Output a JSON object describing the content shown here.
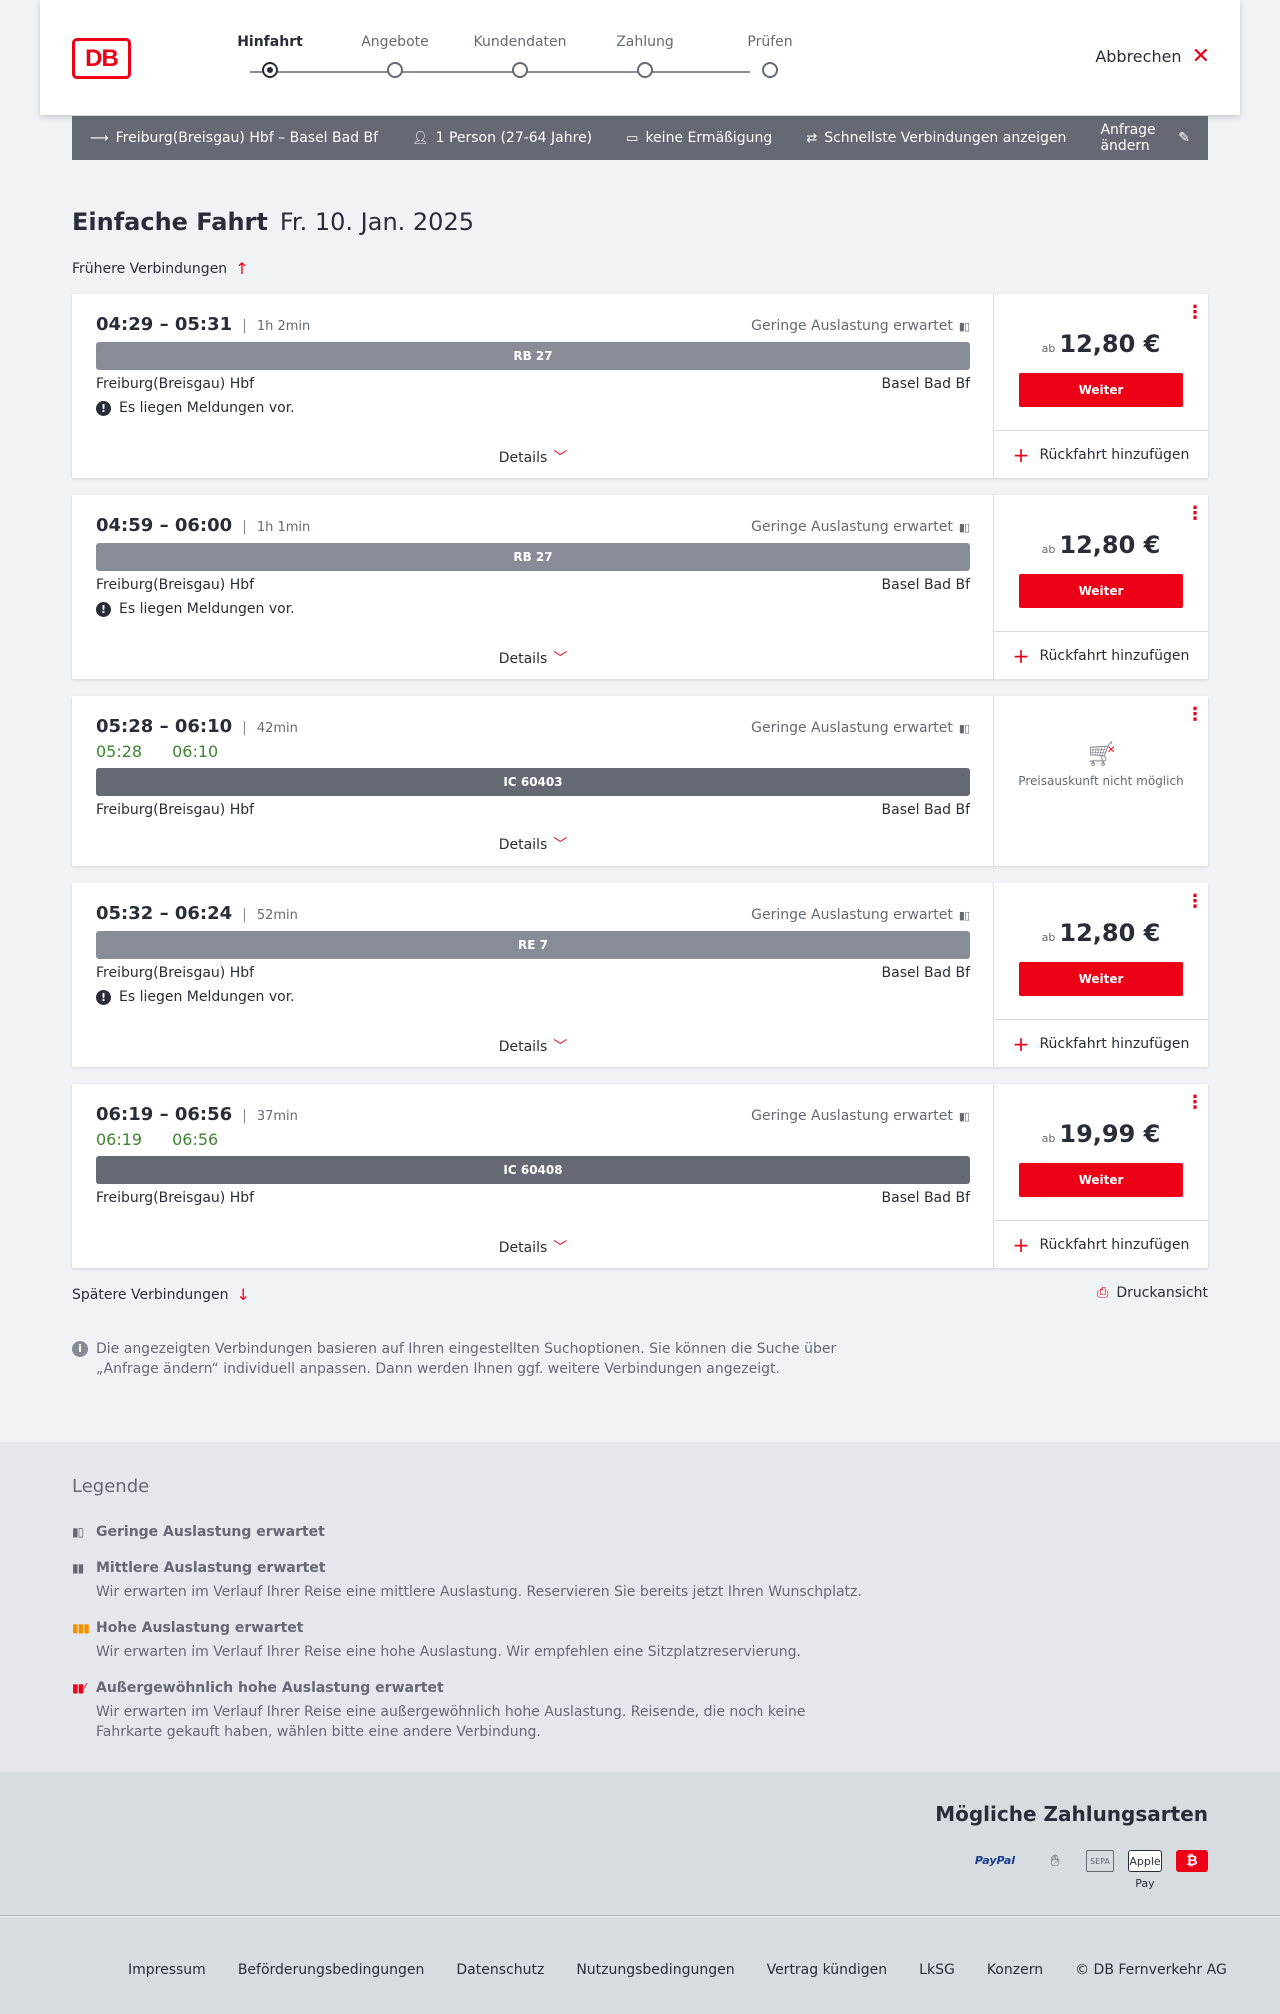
{
  "header": {
    "logo": "DB",
    "steps": [
      "Hinfahrt",
      "Angebote",
      "Kundendaten",
      "Zahlung",
      "Prüfen"
    ],
    "active_step": 0,
    "cancel": "Abbrechen"
  },
  "search": {
    "route": "Freiburg(Breisgau) Hbf – Basel Bad Bf",
    "persons": "1 Person (27-64 Jahre)",
    "discount": "keine Ermäßigung",
    "fastest": "Schnellste Verbindungen anzeigen",
    "edit": "Anfrage ändern"
  },
  "title": {
    "main": "Einfache Fahrt",
    "date": "Fr. 10. Jan. 2025"
  },
  "earlier": "Frühere Verbindungen",
  "later": "Spätere Verbindungen",
  "print": "Druckansicht",
  "connections": [
    {
      "times": "04:29 – 05:31",
      "duration": "1h 2min",
      "load": "Geringe Auslastung erwartet",
      "realtime": null,
      "train": "RB 27",
      "from": "Freiburg(Breisgau) Hbf",
      "to": "Basel Bad Bf",
      "message": "Es liegen Meldungen vor.",
      "details": "Details",
      "price_prefix": "ab",
      "price": "12,80 €",
      "button": "Weiter",
      "return": "Rückfahrt hinzufügen"
    },
    {
      "times": "04:59 – 06:00",
      "duration": "1h 1min",
      "load": "Geringe Auslastung erwartet",
      "realtime": null,
      "train": "RB 27",
      "from": "Freiburg(Breisgau) Hbf",
      "to": "Basel Bad Bf",
      "message": "Es liegen Meldungen vor.",
      "details": "Details",
      "price_prefix": "ab",
      "price": "12,80 €",
      "button": "Weiter",
      "return": "Rückfahrt hinzufügen"
    },
    {
      "times": "05:28 – 06:10",
      "duration": "42min",
      "load": "Geringe Auslastung erwartet",
      "realtime": {
        "dep": "05:28",
        "arr": "06:10"
      },
      "train": "IC 60403",
      "from": "Freiburg(Breisgau) Hbf",
      "to": "Basel Bad Bf",
      "message": null,
      "details": "Details",
      "no_price": "Preisauskunft nicht möglich"
    },
    {
      "times": "05:32 – 06:24",
      "duration": "52min",
      "load": "Geringe Auslastung erwartet",
      "realtime": null,
      "train": "RE 7",
      "from": "Freiburg(Breisgau) Hbf",
      "to": "Basel Bad Bf",
      "message": "Es liegen Meldungen vor.",
      "details": "Details",
      "price_prefix": "ab",
      "price": "12,80 €",
      "button": "Weiter",
      "return": "Rückfahrt hinzufügen"
    },
    {
      "times": "06:19 – 06:56",
      "duration": "37min",
      "load": "Geringe Auslastung erwartet",
      "realtime": {
        "dep": "06:19",
        "arr": "06:56"
      },
      "train": "IC 60408",
      "from": "Freiburg(Breisgau) Hbf",
      "to": "Basel Bad Bf",
      "message": null,
      "details": "Details",
      "price_prefix": "ab",
      "price": "19,99 €",
      "button": "Weiter",
      "return": "Rückfahrt hinzufügen"
    }
  ],
  "info": "Die angezeigten Verbindungen basieren auf Ihren eingestellten Suchoptionen. Sie können die Suche über „Anfrage ändern“ individuell anpassen. Dann werden Ihnen ggf. weitere Verbindungen angezeigt.",
  "legend": {
    "title": "Legende",
    "items": [
      {
        "title": "Geringe Auslastung erwartet",
        "text": "",
        "color": "#646973"
      },
      {
        "title": "Mittlere Auslastung erwartet",
        "text": "Wir erwarten im Verlauf Ihrer Reise eine mittlere Auslastung. Reservieren Sie bereits jetzt Ihren Wunschplatz.",
        "color": "#646973"
      },
      {
        "title": "Hohe Auslastung erwartet",
        "text": "Wir erwarten im Verlauf Ihrer Reise eine hohe Auslastung. Wir empfehlen eine Sitzplatzreservierung.",
        "color": "#f39200"
      },
      {
        "title": "Außergewöhnlich hohe Auslastung erwartet",
        "text": "Wir erwarten im Verlauf Ihrer Reise eine außergewöhnlich hohe Auslastung. Reisende, die noch keine Fahrkarte gekauft haben, wählen bitte eine andere Verbindung.",
        "color": "#ec0016"
      }
    ]
  },
  "payment": {
    "title": "Mögliche Zahlungsarten",
    "methods": [
      "PayPal",
      "Kreditkarte",
      "SEPA",
      "Apple Pay",
      "DB"
    ]
  },
  "footer": {
    "links": [
      "Impressum",
      "Beförderungsbedingungen",
      "Datenschutz",
      "Nutzungsbedingungen",
      "Vertrag kündigen",
      "LkSG",
      "Konzern",
      "© DB Fernverkehr AG"
    ]
  }
}
